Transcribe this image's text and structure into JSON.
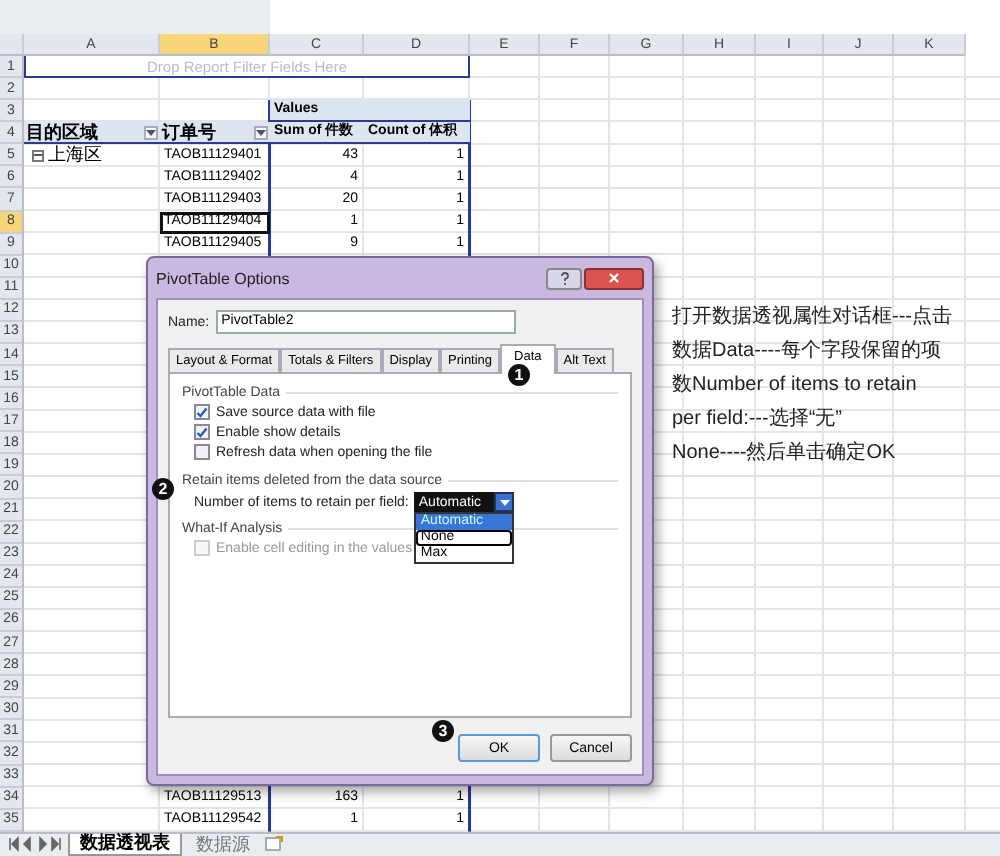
{
  "sheet": {
    "columns": [
      "A",
      "B",
      "C",
      "D",
      "E",
      "F",
      "G",
      "H",
      "I",
      "J",
      "K"
    ],
    "rows": [
      {
        "number": "1",
        "banner": "Drop Report Filter Fields Here"
      },
      {
        "number": "2"
      },
      {
        "number": "3",
        "c": "Values"
      },
      {
        "number": "4",
        "a": "目的区域",
        "b": "订单号",
        "c": "Sum of 件数",
        "d": "Count of 体积",
        "header": true
      },
      {
        "number": "5",
        "a": "上海区",
        "b": "TAOB11129401",
        "c": "43",
        "d": "1",
        "expandable": true
      },
      {
        "number": "6",
        "b": "TAOB11129402",
        "c": "4",
        "d": "1"
      },
      {
        "number": "7",
        "b": "TAOB11129403",
        "c": "20",
        "d": "1"
      },
      {
        "number": "8",
        "b": "TAOB11129404",
        "c": "1",
        "d": "1",
        "selected": true
      },
      {
        "number": "9",
        "b": "TAOB11129405",
        "c": "9",
        "d": "1"
      },
      {
        "number": "10"
      },
      {
        "number": "11"
      },
      {
        "number": "12"
      },
      {
        "number": "13"
      },
      {
        "number": "14"
      },
      {
        "number": "15"
      },
      {
        "number": "16"
      },
      {
        "number": "17"
      },
      {
        "number": "18"
      },
      {
        "number": "19"
      },
      {
        "number": "20"
      },
      {
        "number": "21"
      },
      {
        "number": "22"
      },
      {
        "number": "23"
      },
      {
        "number": "24"
      },
      {
        "number": "25"
      },
      {
        "number": "26"
      },
      {
        "number": "27"
      },
      {
        "number": "28"
      },
      {
        "number": "29"
      },
      {
        "number": "30"
      },
      {
        "number": "31"
      },
      {
        "number": "32"
      },
      {
        "number": "33"
      },
      {
        "number": "34",
        "b": "TAOB11129513",
        "c": "163",
        "d": "1"
      },
      {
        "number": "35",
        "b": "TAOB11129542",
        "c": "1",
        "d": "1"
      }
    ],
    "sheet_tabs": [
      {
        "label": "数据透视表",
        "selected": true
      },
      {
        "label": "数据源",
        "selected": false
      }
    ]
  },
  "annotation": [
    "打开数据透视属性对话框---点击",
    "数据Data----每个字段保留的项",
    "数Number of items to retain",
    "per field:---选择“无”",
    "None----然后单击确定OK"
  ],
  "dialog": {
    "title": "PivotTable Options",
    "name_label": "Name:",
    "name_value": "PivotTable2",
    "tabs": [
      {
        "label": "Layout & Format",
        "selected": false
      },
      {
        "label": "Totals & Filters",
        "selected": false
      },
      {
        "label": "Display",
        "selected": false
      },
      {
        "label": "Printing",
        "selected": false
      },
      {
        "label": "Data",
        "selected": true
      },
      {
        "label": "Alt Text",
        "selected": false
      }
    ],
    "sections": [
      {
        "title": "PivotTable Data",
        "options": [
          {
            "label": "Save source data with file",
            "checked": true,
            "disabled": false
          },
          {
            "label": "Enable show details",
            "checked": true,
            "disabled": false
          },
          {
            "label": "Refresh data when opening the file",
            "checked": false,
            "disabled": false
          }
        ]
      },
      {
        "title": "Retain items deleted from the data source",
        "field_label": "Number of items to retain per field:",
        "field_value": "Automatic",
        "dropdown": [
          {
            "label": "Automatic",
            "selected": true,
            "boxed": false
          },
          {
            "label": "None",
            "selected": false,
            "boxed": true
          },
          {
            "label": "Max",
            "selected": false,
            "boxed": false
          }
        ]
      },
      {
        "title": "What-If Analysis",
        "options": [
          {
            "label": "Enable cell editing in the values",
            "checked": false,
            "disabled": true
          }
        ]
      }
    ],
    "buttons": [
      "OK",
      "Cancel"
    ],
    "steps": [
      "1",
      "2",
      "3"
    ]
  }
}
